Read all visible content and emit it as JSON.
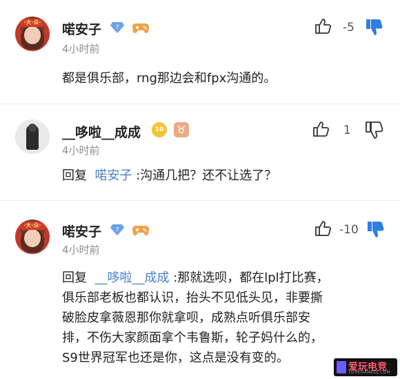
{
  "comments": [
    {
      "username": "喏安子",
      "level_badge": "7",
      "time": "4小时前",
      "text": "都是俱乐部，rng那边会和fpx沟通的。",
      "like_count": "-5",
      "disliked": true
    },
    {
      "username": "__哆啦__成成",
      "level_badge": "10",
      "zodiac_badge": "♉",
      "time": "4小时前",
      "reply_prefix": "回复",
      "reply_to": "喏安子",
      "text": ":沟通几把？还不让选了？",
      "like_count": "1",
      "disliked": false
    },
    {
      "username": "喏安子",
      "level_badge": "7",
      "time": "4小时前",
      "reply_prefix": "回复",
      "reply_to": "__哆啦__成成",
      "text_lines": [
        ":那就选呗，都在lpl打比赛，",
        "俱乐部老板也都认识，抬头不见低头见，非要撕",
        "破脸皮拿薇恩那你就拿呗，成熟点听俱乐部安",
        "排，不伤大家颜面拿个韦鲁斯，轮子妈什么的，",
        "S9世界冠军也还是你，这点是没有变的。"
      ],
      "like_count": "-10",
      "disliked": true
    }
  ],
  "watermark": {
    "text": "爱玩电竞",
    "sub": "LOVEGAMEDJ.COM"
  },
  "colors": {
    "accent_blue": "#4a7fc7",
    "dislike_active": "#2f7fe0",
    "gold": "#f5c531"
  }
}
